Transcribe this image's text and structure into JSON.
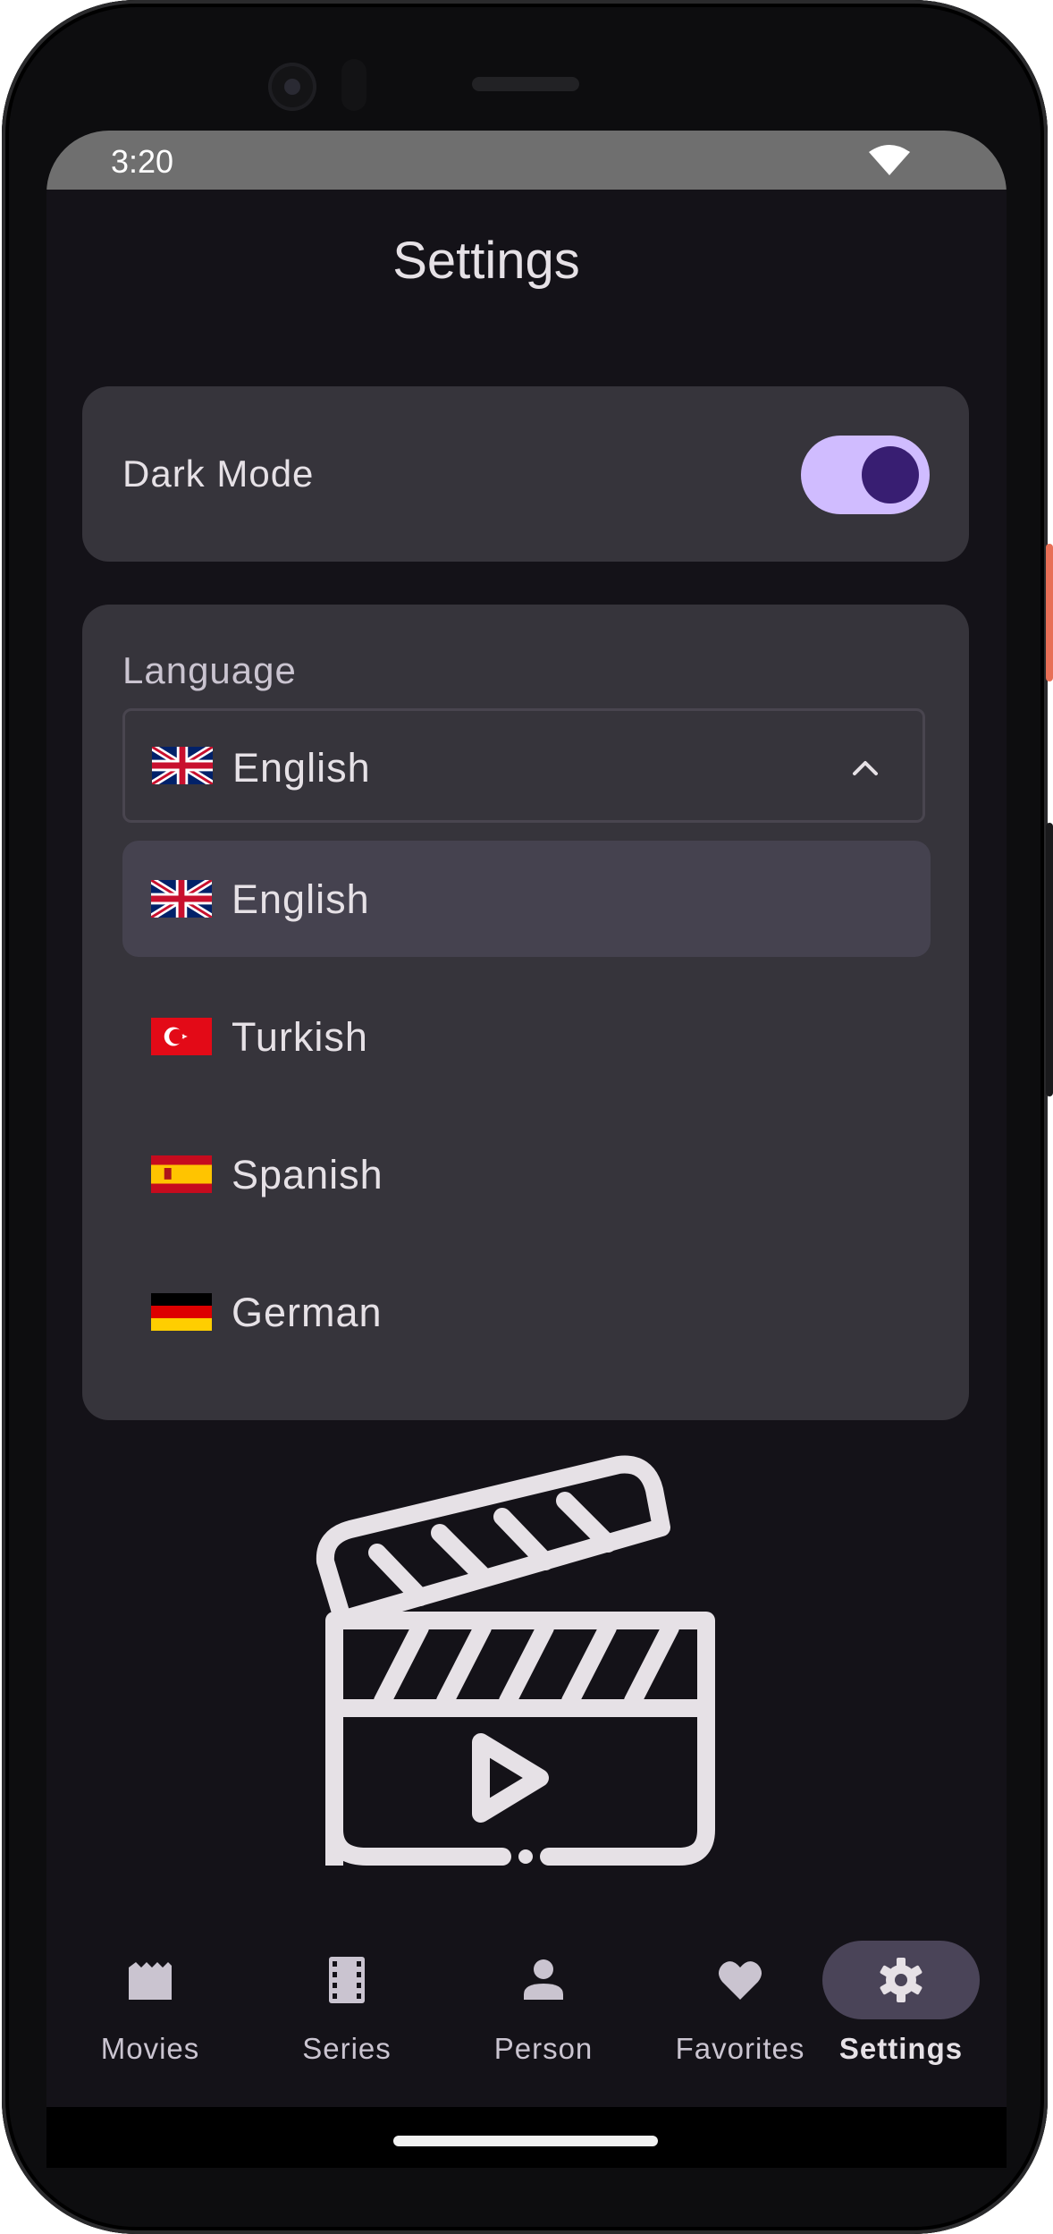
{
  "status_bar": {
    "time": "3:20",
    "wifi_icon": "wifi-icon"
  },
  "page": {
    "title": "Settings"
  },
  "dark_mode": {
    "label": "Dark Mode",
    "enabled": true,
    "track_color": "#d0bcff",
    "thumb_color": "#381e72"
  },
  "language": {
    "label": "Language",
    "selected": {
      "label": "English",
      "flag": "uk-flag-icon"
    },
    "options": [
      {
        "label": "English",
        "flag": "uk-flag-icon",
        "selected": true
      },
      {
        "label": "Turkish",
        "flag": "turkey-flag-icon",
        "selected": false
      },
      {
        "label": "Spanish",
        "flag": "spain-flag-icon",
        "selected": false
      },
      {
        "label": "German",
        "flag": "germany-flag-icon",
        "selected": false
      }
    ]
  },
  "illustration": {
    "icon": "clapperboard-play-icon"
  },
  "bottom_nav": {
    "items": [
      {
        "label": "Movies",
        "icon": "movie-icon",
        "active": false
      },
      {
        "label": "Series",
        "icon": "film-strip-icon",
        "active": false
      },
      {
        "label": "Person",
        "icon": "person-icon",
        "active": false
      },
      {
        "label": "Favorites",
        "icon": "heart-icon",
        "active": false
      },
      {
        "label": "Settings",
        "icon": "gear-icon",
        "active": true
      }
    ]
  },
  "colors": {
    "background": "#141218",
    "card": "#36343b",
    "selected_option": "#45424f",
    "active_nav_pill": "#4a4458",
    "text_primary": "#e6e1e6"
  }
}
